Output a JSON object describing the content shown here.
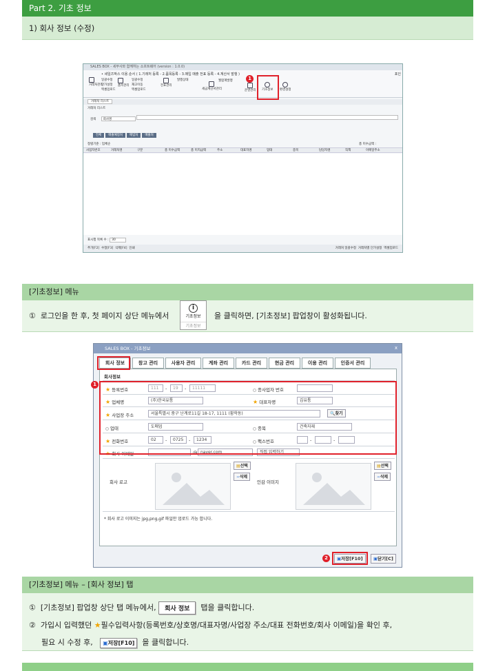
{
  "header": {
    "part_title": "Part 2. 기초 정보",
    "section": "1) 회사 정보 (수정)"
  },
  "shot1": {
    "title": "SALES BOX - 세무사와 함께하는 소프트웨어 (version : 1.0.0)",
    "menu": "• 세일즈박스 이용 순서 ( 1.기래처 등록 - 2.품목등록 - 3.매입 매출 전표 등록 - 4.계산서 발행 )",
    "right_hint": "포인",
    "g1": [
      "거래처관리",
      "일괄수정",
      "단가설정",
      "엑셀업로드",
      "거래처 관리"
    ],
    "g2": [
      "품목관리",
      "일괄수정",
      "재고이동",
      "엑셀업로드",
      "품목관리"
    ],
    "g3": [
      "발행상태",
      "전표관리",
      "전표관리"
    ],
    "g4": [
      "세금계산서관리",
      "월합계발행",
      "세금계산서관리"
    ],
    "g5": [
      "운영관리",
      "운영관리"
    ],
    "g6": [
      "기초정보",
      "기초정보"
    ],
    "g7": [
      "환경설정",
      "환경설정"
    ],
    "tab": "거래처 리스트",
    "list_title": "거래처 리스트",
    "search_label": "검색",
    "search_field": "회사명",
    "buttons": [
      "전체",
      "매출예정처",
      "매입처",
      "매출처"
    ],
    "sort_label": "정렬기준 : 업체순",
    "right_label": "총 미수금액 :",
    "cols": [
      "사업자번호",
      "거래처명",
      "구분",
      "총 미수금액",
      "총 미지급액",
      "주소",
      "대표자명",
      "업태",
      "종목",
      "담당자명",
      "직책",
      "이메일주소"
    ],
    "paging_label": "표시행 목록 수 :",
    "paging_value": "30",
    "footer_left": [
      "추가[F2]",
      "수정[F3]",
      "삭제[F4]",
      "인쇄"
    ],
    "footer_right": [
      "거래처 일괄수정",
      "거래처별 단가설정",
      "엑셀업로드"
    ]
  },
  "step_labels": {
    "one": "1",
    "two": "2"
  },
  "section2": {
    "title": "[기초정보] 메뉴",
    "num": "①",
    "text_before": "로그인을 한 후, 첫 페이지 상단 메뉴에서",
    "icon_label": "기초정보",
    "icon_sub": "기초정보",
    "text_after": "을 클릭하면, [기초정보] 팝업창이 활성화됩니다."
  },
  "dialog": {
    "title": "SALES BOX - 기초정보",
    "close": "x",
    "tabs": [
      "회사 정보",
      "창고 관리",
      "사용자 관리",
      "계좌 관리",
      "카드 관리",
      "현금 관리",
      "이용 관리",
      "인증서 관리"
    ],
    "panel_title": "회사정보",
    "labels": {
      "reg_no": "등록번호",
      "branch_no": "종사업자 번호",
      "company": "업체명",
      "ceo": "대표자명",
      "address": "사업장 주소",
      "biz_type": "업태",
      "biz_item": "종목",
      "phone": "전화번호",
      "fax": "팩스번호",
      "email": "회사 이메일",
      "logo": "회사 로고",
      "stamp": "인감 이미지"
    },
    "values": {
      "reg1": "111",
      "reg2": "19",
      "reg3": "11111",
      "company": "(주)한국유통",
      "ceo": "김유통",
      "address": "서울특별시 중구 난계로11길 18-17, 1111 (황학동)",
      "find": "찾기",
      "biz_type": "도매업",
      "biz_item": "건축자재",
      "ph1": "02",
      "ph2": "0725",
      "ph3": "1234",
      "email_domain": "naver.com",
      "email_mode": "직접 입력하기",
      "dash": "-",
      "at": "@"
    },
    "select_btn": "선택",
    "delete_btn": "삭제",
    "note": "* 회사 로고 이미지는 jpg,png,gif 파일만 업로드 가능 합니다.",
    "save": "저장[F10]",
    "close_btn": "닫기[C]"
  },
  "section3": {
    "title": "[기초정보] 메뉴 – [회사 정보] 탭",
    "num1": "①",
    "line1_before": "[기초정보] 팝업창 상단 탭 메뉴에서,",
    "tab_chip": "회사 정보",
    "line1_after": "탭을 클릭합니다.",
    "num2": "②",
    "line2_before": "가입시 입력했던",
    "line2_after": "필수입력사항(등록번호/상호명/대표자명/사업장 주소/대표 전화번호/회사 이메일)을 확인 후,",
    "line3_before": "필요 시 수정 후,",
    "save_chip": "저장[F10]",
    "line3_after": "을 클릭합니다."
  },
  "colors": {
    "green": "#3d9e41",
    "light": "#d6ecd3",
    "red": "#e0202a",
    "star": "#f0a500"
  }
}
